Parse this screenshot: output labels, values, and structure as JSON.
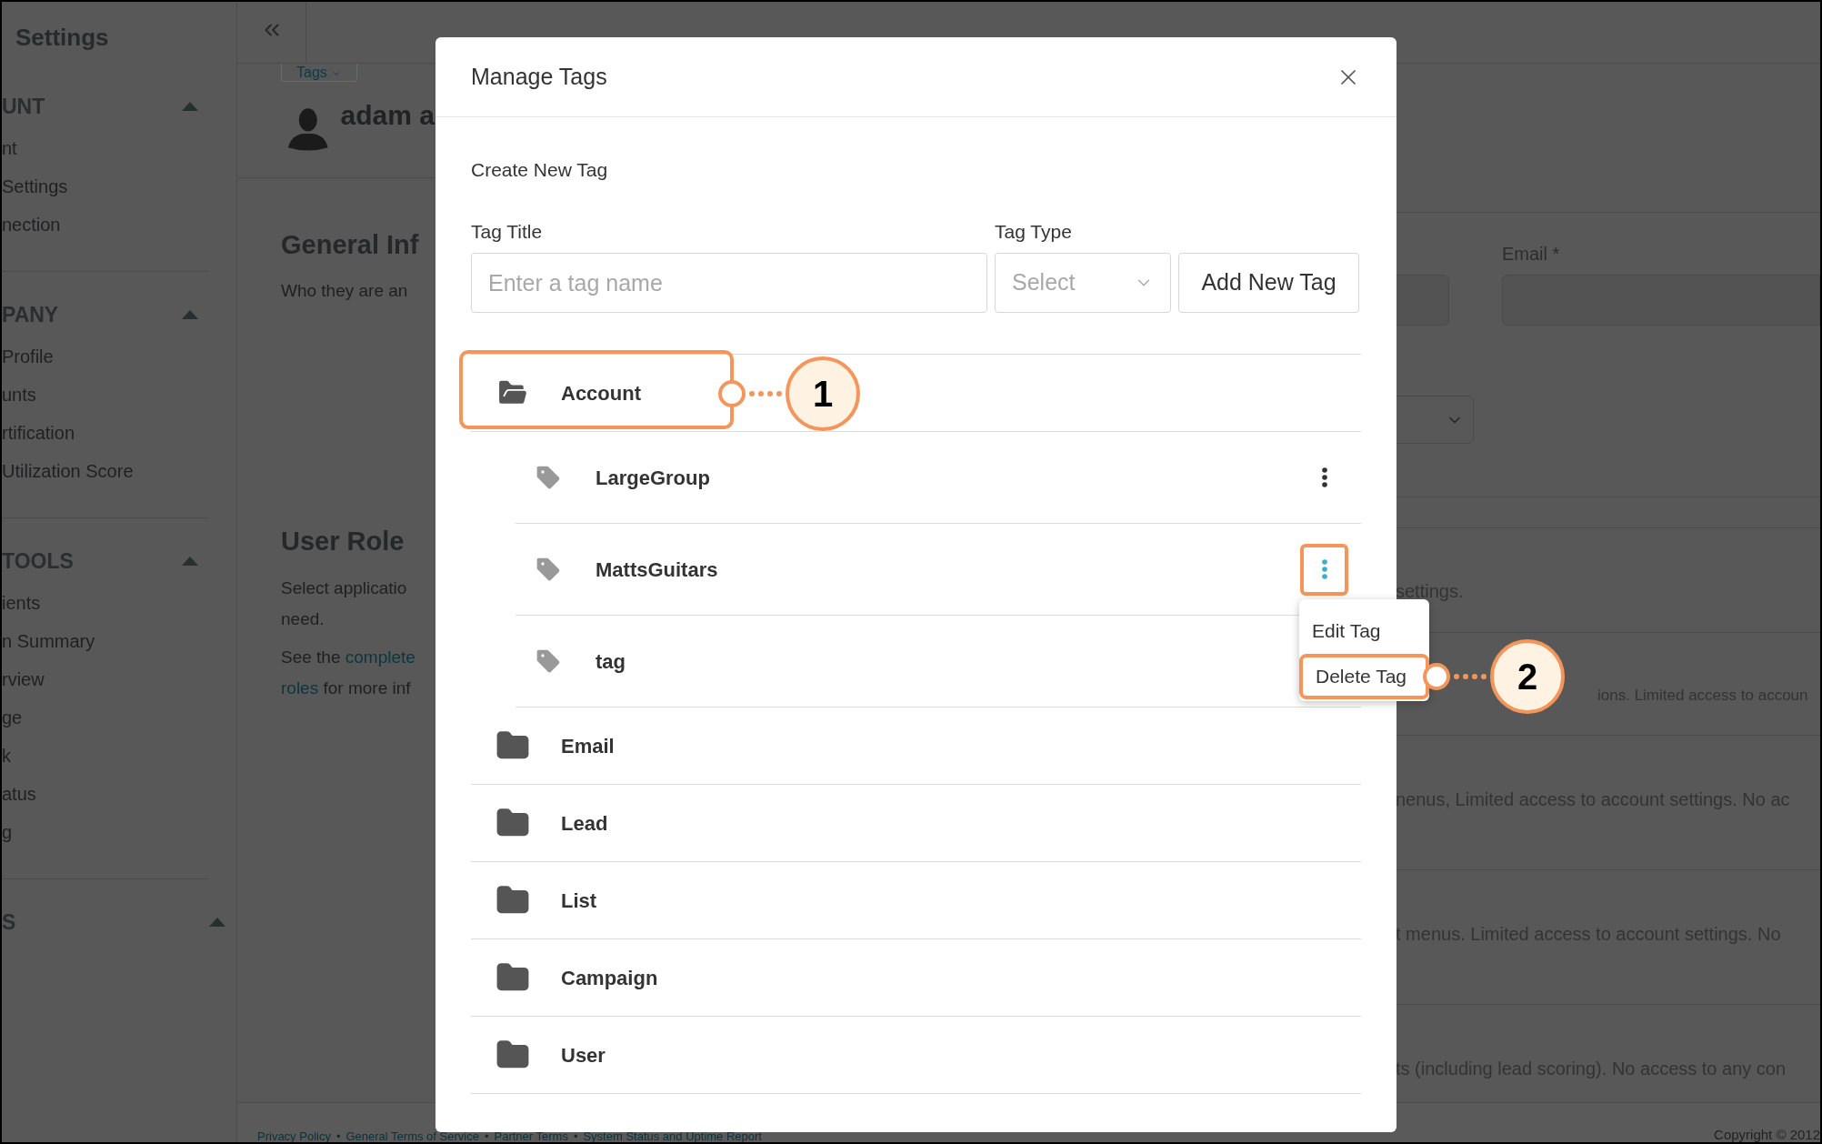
{
  "sidebar": {
    "title": "Settings",
    "sections": [
      {
        "label": "UNT",
        "expanded": true,
        "items": [
          "nt",
          "Settings",
          "nection"
        ]
      },
      {
        "label": "PANY",
        "expanded": true,
        "items": [
          "Profile",
          "unts",
          "rtification",
          "Utilization Score"
        ]
      },
      {
        "label": "TOOLS",
        "expanded": true,
        "items": [
          "ients",
          "n Summary",
          "rview",
          "ge",
          "k",
          "atus",
          "g"
        ]
      },
      {
        "label": "S",
        "expanded": true
      }
    ]
  },
  "page": {
    "tags_button": "Tags",
    "profile_name": "adam a",
    "general_heading": "General Inf",
    "general_text": "Who they are an",
    "role_heading": "User Role",
    "role_lines": [
      "Select applicatio",
      "need."
    ],
    "role_link_lines": [
      [
        {
          "text": "See the ",
          "link": false
        },
        {
          "text": "complete",
          "link": true
        }
      ],
      [
        {
          "text": "roles",
          "link": true
        },
        {
          "text": " for more inf",
          "link": false
        }
      ]
    ],
    "email_label": "Email *",
    "role_descriptions": [
      "settings.",
      "ions. Limited access to accoun",
      "nenus, Limited access to account settings. No ac",
      "t menus. Limited access to account settings. No",
      "ts (including lead scoring). No access to any con"
    ]
  },
  "footer": {
    "links": [
      "Privacy Policy",
      "General Terms of Service",
      "Partner Terms",
      "System Status and Uptime Report"
    ],
    "separator": "•",
    "copyright": "Copyright © 2012"
  },
  "modal": {
    "title": "Manage Tags",
    "section": "Create New Tag",
    "title_label": "Tag Title",
    "title_placeholder": "Enter a tag name",
    "type_label": "Tag Type",
    "type_placeholder": "Select",
    "add_button": "Add New Tag",
    "folders": [
      {
        "name": "Account",
        "expanded": true,
        "annotation": "1",
        "children": [
          {
            "name": "LargeGroup",
            "menu_button": true,
            "menu_open": false
          },
          {
            "name": "MattsGuitars",
            "menu_button": true,
            "menu_open": true,
            "menu": [
              {
                "label": "Edit Tag"
              },
              {
                "label": "Delete Tag",
                "annotation": "2"
              }
            ]
          },
          {
            "name": "tag",
            "menu_button": false,
            "menu_open": false
          }
        ]
      },
      {
        "name": "Email",
        "expanded": false
      },
      {
        "name": "Lead",
        "expanded": false
      },
      {
        "name": "List",
        "expanded": false
      },
      {
        "name": "Campaign",
        "expanded": false
      },
      {
        "name": "User",
        "expanded": false
      }
    ]
  }
}
